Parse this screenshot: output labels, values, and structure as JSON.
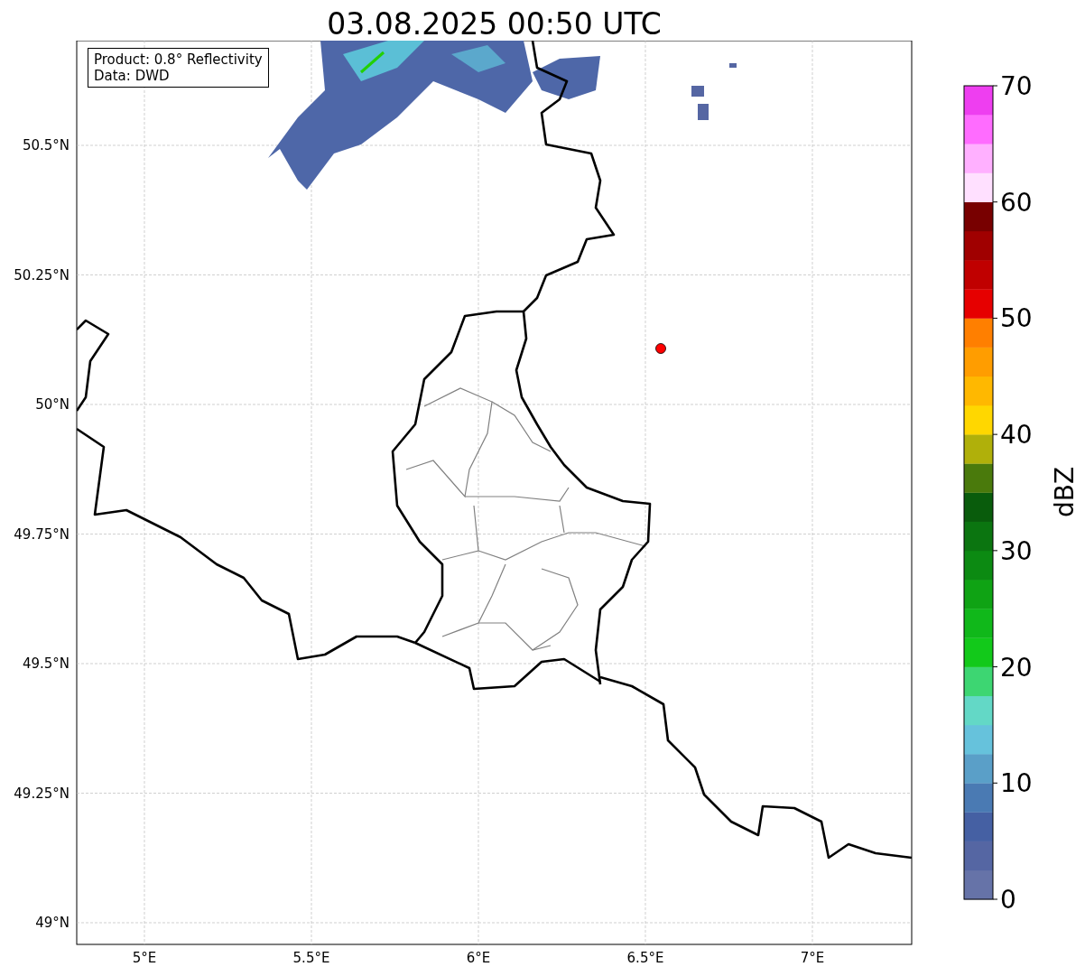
{
  "title": "03.08.2025 00:50 UTC",
  "info_box": {
    "lines": [
      "Product: 0.8° Reflectivity",
      "Data: DWD"
    ]
  },
  "map": {
    "lon_labels": [
      "5°E",
      "5.5°E",
      "6°E",
      "6.5°E",
      "7°E"
    ],
    "lat_labels": [
      "50.5°N",
      "50.25°N",
      "50°N",
      "49.75°N",
      "49.5°N",
      "49.25°N",
      "49°N"
    ]
  },
  "colorbar": {
    "label": "dBZ",
    "ticks": [
      "70",
      "60",
      "50",
      "40",
      "30",
      "20",
      "10",
      "0"
    ],
    "segments": [
      {
        "color": "#6673a8"
      },
      {
        "color": "#5566a3"
      },
      {
        "color": "#4560a3"
      },
      {
        "color": "#4a7ab3"
      },
      {
        "color": "#5a9fc8"
      },
      {
        "color": "#66c2dc"
      },
      {
        "color": "#63d8c6"
      },
      {
        "color": "#3dd672"
      },
      {
        "color": "#12c91a"
      },
      {
        "color": "#10b81a"
      },
      {
        "color": "#0fa314"
      },
      {
        "color": "#0c8a12"
      },
      {
        "color": "#0b7510"
      },
      {
        "color": "#095c0c"
      },
      {
        "color": "#4a7a0c"
      },
      {
        "color": "#b0b00a"
      },
      {
        "color": "#ffd700"
      },
      {
        "color": "#ffb800"
      },
      {
        "color": "#ff9d00"
      },
      {
        "color": "#ff7f00"
      },
      {
        "color": "#e60000"
      },
      {
        "color": "#c00000"
      },
      {
        "color": "#a00000"
      },
      {
        "color": "#780000"
      },
      {
        "color": "#ffe0ff"
      },
      {
        "color": "#ffb0ff"
      },
      {
        "color": "#ff6cff"
      },
      {
        "color": "#ee3ef0"
      }
    ]
  }
}
